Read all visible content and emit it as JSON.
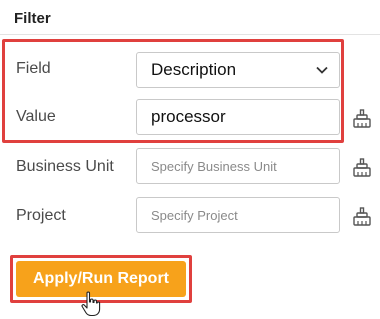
{
  "filter": {
    "title": "Filter",
    "rows": {
      "field": {
        "label": "Field",
        "value": "Description"
      },
      "value": {
        "label": "Value",
        "value": "processor"
      },
      "business_unit": {
        "label": "Business Unit",
        "placeholder": "Specify Business Unit"
      },
      "project": {
        "label": "Project",
        "placeholder": "Specify Project"
      }
    },
    "button": {
      "label": "Apply/Run Report"
    }
  },
  "colors": {
    "highlight": "#e0403e",
    "button_bg": "#f7a21b",
    "button_text": "#ffffff"
  }
}
